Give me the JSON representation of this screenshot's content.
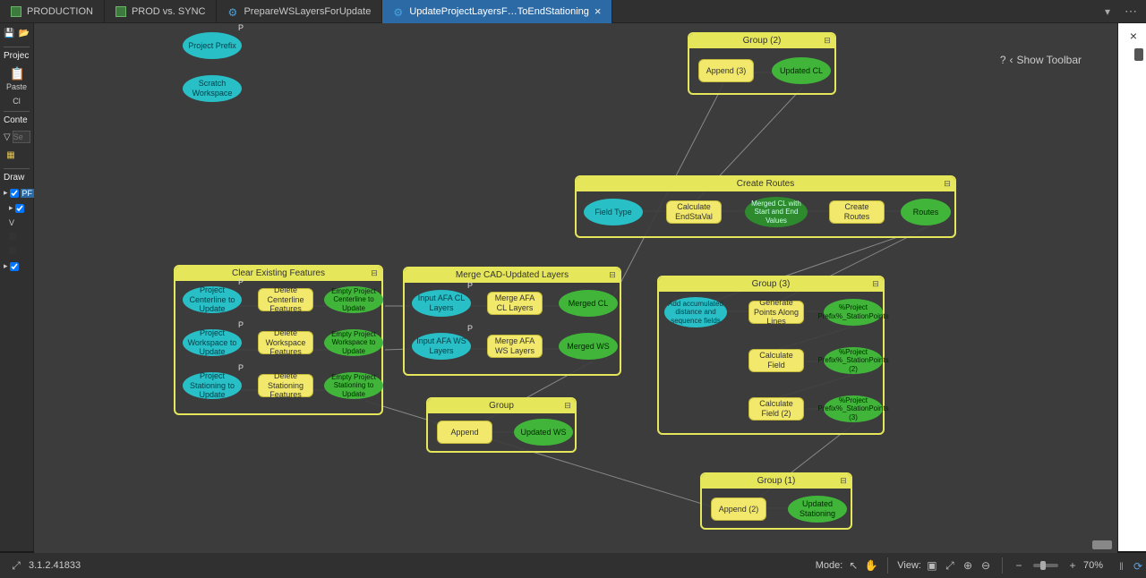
{
  "tabs": [
    {
      "label": "PRODUCTION"
    },
    {
      "label": "PROD vs. SYNC"
    },
    {
      "label": "PrepareWSLayersForUpdate"
    },
    {
      "label": "UpdateProjectLayersF…ToEndStationing"
    }
  ],
  "show_toolbar": "Show Toolbar",
  "left": {
    "p1": "Projec",
    "paste": "Paste",
    "cl": "Cl",
    "contents": "Conte",
    "search_ph": "Se",
    "draw": "Draw",
    "item_pf": "PF",
    "item_v": "V"
  },
  "floating": {
    "project_prefix": "Project Prefix",
    "scratch_workspace": "Scratch Workspace"
  },
  "group2": {
    "title": "Group (2)",
    "append": "Append (3)",
    "updated_cl": "Updated CL"
  },
  "create_routes": {
    "title": "Create Routes",
    "field_type": "Field Type",
    "calc": "Calculate EndStaVal",
    "merged": "Merged CL with Start and End Values",
    "cr": "Create Routes",
    "routes": "Routes"
  },
  "clear_existing": {
    "title": "Clear Existing Features",
    "r1_in": "Project Centerline to Update",
    "r1_tool": "Delete Centerline Features",
    "r1_out": "Empty Project Centerline to Update",
    "r2_in": "Project Workspace to Update",
    "r2_tool": "Delete Workspace Features",
    "r2_out": "Empty Project Workspace to Update",
    "r3_in": "Project Stationing to Update",
    "r3_tool": "Delete Stationing Features",
    "r3_out": "Empty Project Stationing to Update"
  },
  "merge_cad": {
    "title": "Merge CAD-Updated Layers",
    "r1_in": "Input AFA CL Layers",
    "r1_tool": "Merge AFA CL Layers",
    "r1_out": "Merged CL",
    "r2_in": "Input AFA WS Layers",
    "r2_tool": "Merge AFA WS Layers",
    "r2_out": "Merged WS"
  },
  "group": {
    "title": "Group",
    "append": "Append",
    "updated_ws": "Updated WS"
  },
  "group3": {
    "title": "Group (3)",
    "add_acc": "Add accumulated distance and sequence fields",
    "gen_points": "Generate Points Along Lines",
    "pp1": "%Project Prefix%_StationPoints",
    "calc1": "Calculate Field",
    "pp2": "%Project Prefix%_StationPoints (2)",
    "calc2": "Calculate Field (2)",
    "pp3": "%Project Prefix%_StationPoints (3)"
  },
  "group1": {
    "title": "Group (1)",
    "append": "Append (2)",
    "updated_st": "Updated Stationing"
  },
  "status": {
    "expand": "⤢",
    "version": "3.1.2.41833",
    "mode": "Mode:",
    "view": "View:",
    "zoom": "70%"
  },
  "chart_data": {
    "type": "diagram",
    "description": "ModelBuilder-style data-flow diagram. Blue ellipses = input/variable, yellow rounded rectangles = tools/processes, green ellipses = outputs. Groups are yellow-outlined boxes.",
    "standalone_variables": [
      "Project Prefix",
      "Scratch Workspace"
    ],
    "groups": [
      {
        "name": "Group (2)",
        "chain": [
          "Append (3)",
          "Updated CL"
        ]
      },
      {
        "name": "Create Routes",
        "chain": [
          "Field Type",
          "Calculate EndStaVal",
          "Merged CL with Start and End Values",
          "Create Routes",
          "Routes"
        ]
      },
      {
        "name": "Clear Existing Features",
        "rows": [
          [
            "Project Centerline to Update",
            "Delete Centerline Features",
            "Empty Project Centerline to Update"
          ],
          [
            "Project Workspace to Update",
            "Delete Workspace Features",
            "Empty Project Workspace to Update"
          ],
          [
            "Project Stationing to Update",
            "Delete Stationing Features",
            "Empty Project Stationing to Update"
          ]
        ]
      },
      {
        "name": "Merge CAD-Updated Layers",
        "rows": [
          [
            "Input AFA CL Layers",
            "Merge AFA CL Layers",
            "Merged CL"
          ],
          [
            "Input AFA WS Layers",
            "Merge AFA WS Layers",
            "Merged WS"
          ]
        ]
      },
      {
        "name": "Group",
        "chain": [
          "Append",
          "Updated WS"
        ]
      },
      {
        "name": "Group (3)",
        "rows": [
          [
            "Add accumulated distance and sequence fields",
            "Generate Points Along Lines",
            "%Project Prefix%_StationPoints"
          ],
          [
            "",
            "Calculate Field",
            "%Project Prefix%_StationPoints (2)"
          ],
          [
            "",
            "Calculate Field (2)",
            "%Project Prefix%_StationPoints (3)"
          ]
        ]
      },
      {
        "name": "Group (1)",
        "chain": [
          "Append (2)",
          "Updated Stationing"
        ]
      }
    ],
    "cross_group_edges": [
      [
        "Updated CL",
        "Calculate EndStaVal"
      ],
      [
        "Merged CL",
        "Append (3)"
      ],
      [
        "Merged WS",
        "Append"
      ],
      [
        "Empty Project Centerline to Update",
        "Merge AFA CL Layers"
      ],
      [
        "Empty Project Workspace to Update",
        "Merge AFA WS Layers"
      ],
      [
        "Routes",
        "Generate Points Along Lines"
      ],
      [
        "Routes",
        "Add accumulated distance and sequence fields"
      ],
      [
        "%Project Prefix%_StationPoints (3)",
        "Append (2)"
      ],
      [
        "Empty Project Stationing to Update",
        "Append (2)"
      ]
    ]
  }
}
